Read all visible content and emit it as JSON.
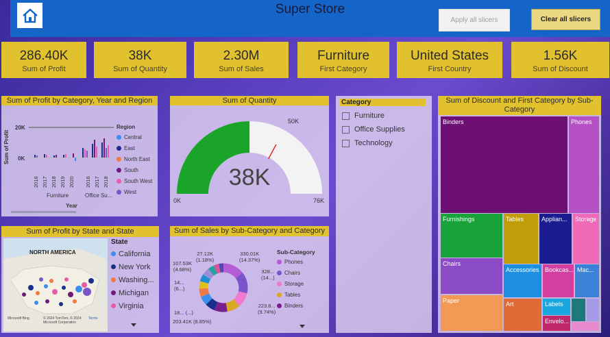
{
  "header": {
    "title": "Super Store",
    "apply_label": "Apply all slicers",
    "clear_label": "Clear all slicers"
  },
  "kpis": [
    {
      "value": "286.40K",
      "label": "Sum of Profit"
    },
    {
      "value": "38K",
      "label": "Sum of Quantity"
    },
    {
      "value": "2.30M",
      "label": "Sum of Sales"
    },
    {
      "value": "Furniture",
      "label": "First Category"
    },
    {
      "value": "United States",
      "label": "First Country"
    },
    {
      "value": "1.56K",
      "label": "Sum of Discount"
    }
  ],
  "profit_chart": {
    "title": "Sum of Profit by Category, Year and Region",
    "ylabel": "Sum of Profit",
    "xlabel": "Year",
    "yticks": [
      "20K",
      "0K"
    ],
    "years": [
      "2016",
      "2017",
      "2018",
      "2019",
      "2020",
      "2016",
      "2017",
      "2018"
    ],
    "groups": [
      "Furniture",
      "Office Su..."
    ],
    "legend_title": "Region",
    "legend": [
      {
        "name": "Central",
        "color": "#3b8df0"
      },
      {
        "name": "East",
        "color": "#1b2f8a"
      },
      {
        "name": "North East",
        "color": "#ee7a45"
      },
      {
        "name": "South",
        "color": "#6d1a78"
      },
      {
        "name": "South West",
        "color": "#e65aa8"
      },
      {
        "name": "West",
        "color": "#7a55c8"
      }
    ]
  },
  "gauge": {
    "title": "Sum of Quantity",
    "value_label": "38K",
    "min_label": "0K",
    "max_label": "76K",
    "target_label": "50K",
    "value": 38000,
    "min": 0,
    "max": 76000,
    "target": 50000,
    "color": "#1aa52a"
  },
  "slicer": {
    "title": "Category",
    "items": [
      "Furniture",
      "Office Supplies",
      "Technology"
    ]
  },
  "map": {
    "title": "Sum of Profit by State and State",
    "region_label": "NORTH AMERICA",
    "legend_title": "State",
    "legend": [
      {
        "name": "California",
        "color": "#3b8df0"
      },
      {
        "name": "New York",
        "color": "#1b2f8a"
      },
      {
        "name": "Washing...",
        "color": "#ee7a45"
      },
      {
        "name": "Michigan",
        "color": "#6d1a78"
      },
      {
        "name": "Virginia",
        "color": "#e65aa8"
      }
    ],
    "attribution": "© 2024 TomTom, © 2024 Microsoft Corporation",
    "terms": "Terms",
    "brand": "Microsoft Bing"
  },
  "donut": {
    "title": "Sum of Sales by Sub-Category and Category",
    "legend_title": "Sub-Category",
    "legend": [
      {
        "name": "Phones",
        "color": "#b45cd6"
      },
      {
        "name": "Chairs",
        "color": "#7a55c8"
      },
      {
        "name": "Storage",
        "color": "#f07ad0"
      },
      {
        "name": "Tables",
        "color": "#d9a825"
      },
      {
        "name": "Binders",
        "color": "#7a1f8e"
      }
    ],
    "labels": [
      {
        "text": "27.12K",
        "sub": "(1.18%)"
      },
      {
        "text": "107.53K",
        "sub": "(4.68%)"
      },
      {
        "text": "14...",
        "sub": "(6...)"
      },
      {
        "text": "18...",
        "sub": "(...)"
      },
      {
        "text": "203.41K (8.85%)",
        "sub": ""
      },
      {
        "text": "330.01K",
        "sub": "(14.37%)"
      },
      {
        "text": "328...",
        "sub": "(14...)"
      },
      {
        "text": "223.8...",
        "sub": "(9.74%)"
      }
    ]
  },
  "treemap": {
    "title": "Sum of Discount and First Category by Sub-Category",
    "cells": [
      "Binders",
      "Phones",
      "Furnishings",
      "Tables",
      "Applian...",
      "Storage",
      "Chairs",
      "Accessories",
      "Bookcas...",
      "Mac...",
      "Paper",
      "Art",
      "Labels",
      "Envelo..."
    ]
  },
  "colors": {
    "accent": "#e2c12f",
    "header": "#1565c9"
  }
}
